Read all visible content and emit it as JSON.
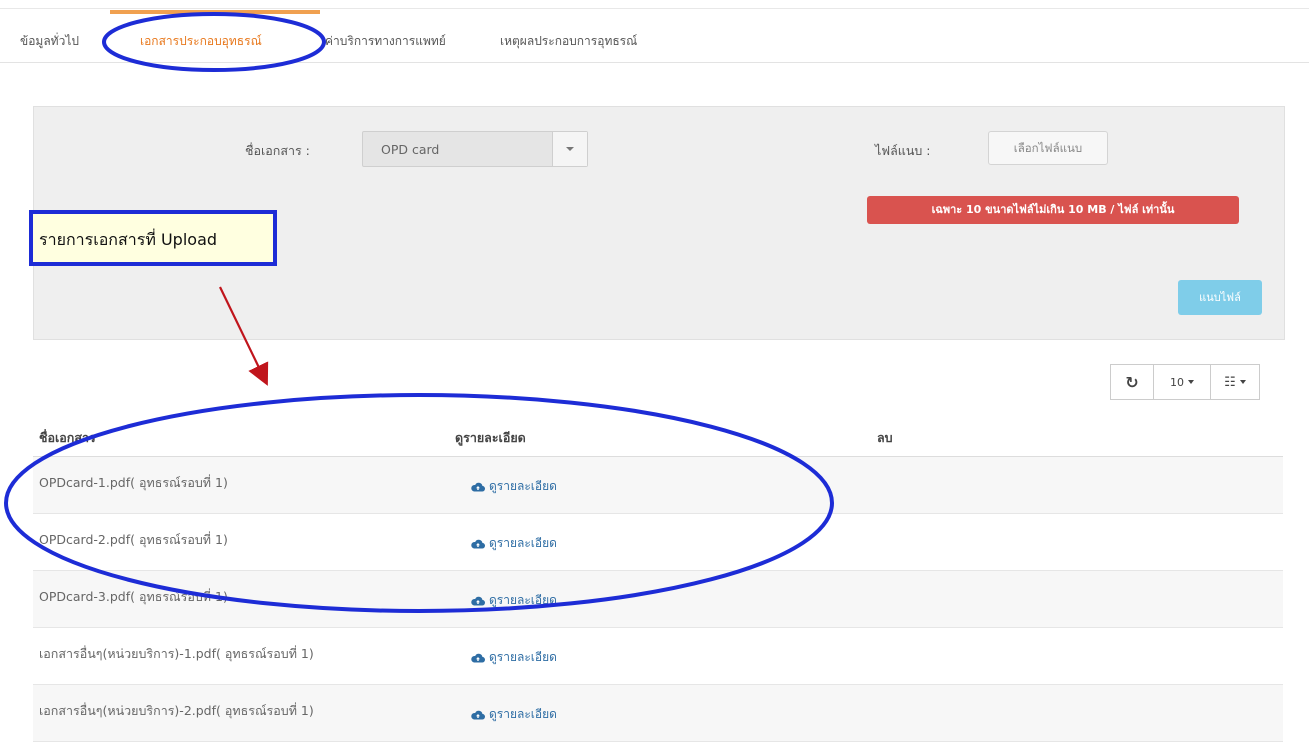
{
  "tabs": [
    {
      "label": "ข้อมูลทั่วไป",
      "active": false
    },
    {
      "label": "เอกสารประกอบอุทธรณ์",
      "active": true
    },
    {
      "label": "ค่าบริการทางการแพทย์",
      "active": false
    },
    {
      "label": "เหตุผลประกอบการอุทธรณ์",
      "active": false
    }
  ],
  "form": {
    "doc_name_label": "ชื่อเอกสาร :",
    "doc_select_value": "OPD card",
    "attach_label": "ไฟล์แนบ :",
    "choose_file_label": "เลือกไฟล์แนบ",
    "warning_text": "เฉพาะ 10 ขนาดไฟล์ไม่เกิน 10 MB / ไฟล์ เท่านั้น",
    "upload_label": "แนบไฟล์"
  },
  "annotation": {
    "callout_text": "รายการเอกสารที่ Upload",
    "color": "#1d2cd6",
    "arrow_color": "#c0151c"
  },
  "toolbar": {
    "page_size": "10"
  },
  "table": {
    "headers": [
      "ชื่อเอกสาร",
      "ดูรายละเอียด",
      "ลบ"
    ],
    "rows": [
      {
        "name": "OPDcard-1.pdf( อุทธรณ์รอบที่ 1)",
        "detail": "ดูรายละเอียด"
      },
      {
        "name": "OPDcard-2.pdf( อุทธรณ์รอบที่ 1)",
        "detail": "ดูรายละเอียด"
      },
      {
        "name": "OPDcard-3.pdf( อุทธรณ์รอบที่ 1)",
        "detail": "ดูรายละเอียด"
      },
      {
        "name": "เอกสารอื่นๆ(หน่วยบริการ)-1.pdf( อุทธรณ์รอบที่ 1)",
        "detail": "ดูรายละเอียด"
      },
      {
        "name": "เอกสารอื่นๆ(หน่วยบริการ)-2.pdf( อุทธรณ์รอบที่ 1)",
        "detail": "ดูรายละเอียด"
      }
    ]
  },
  "colors": {
    "accent_tab": "#e8791e",
    "danger": "#d9534f",
    "upload_btn": "#7fcde9",
    "link": "#2e6da4"
  }
}
